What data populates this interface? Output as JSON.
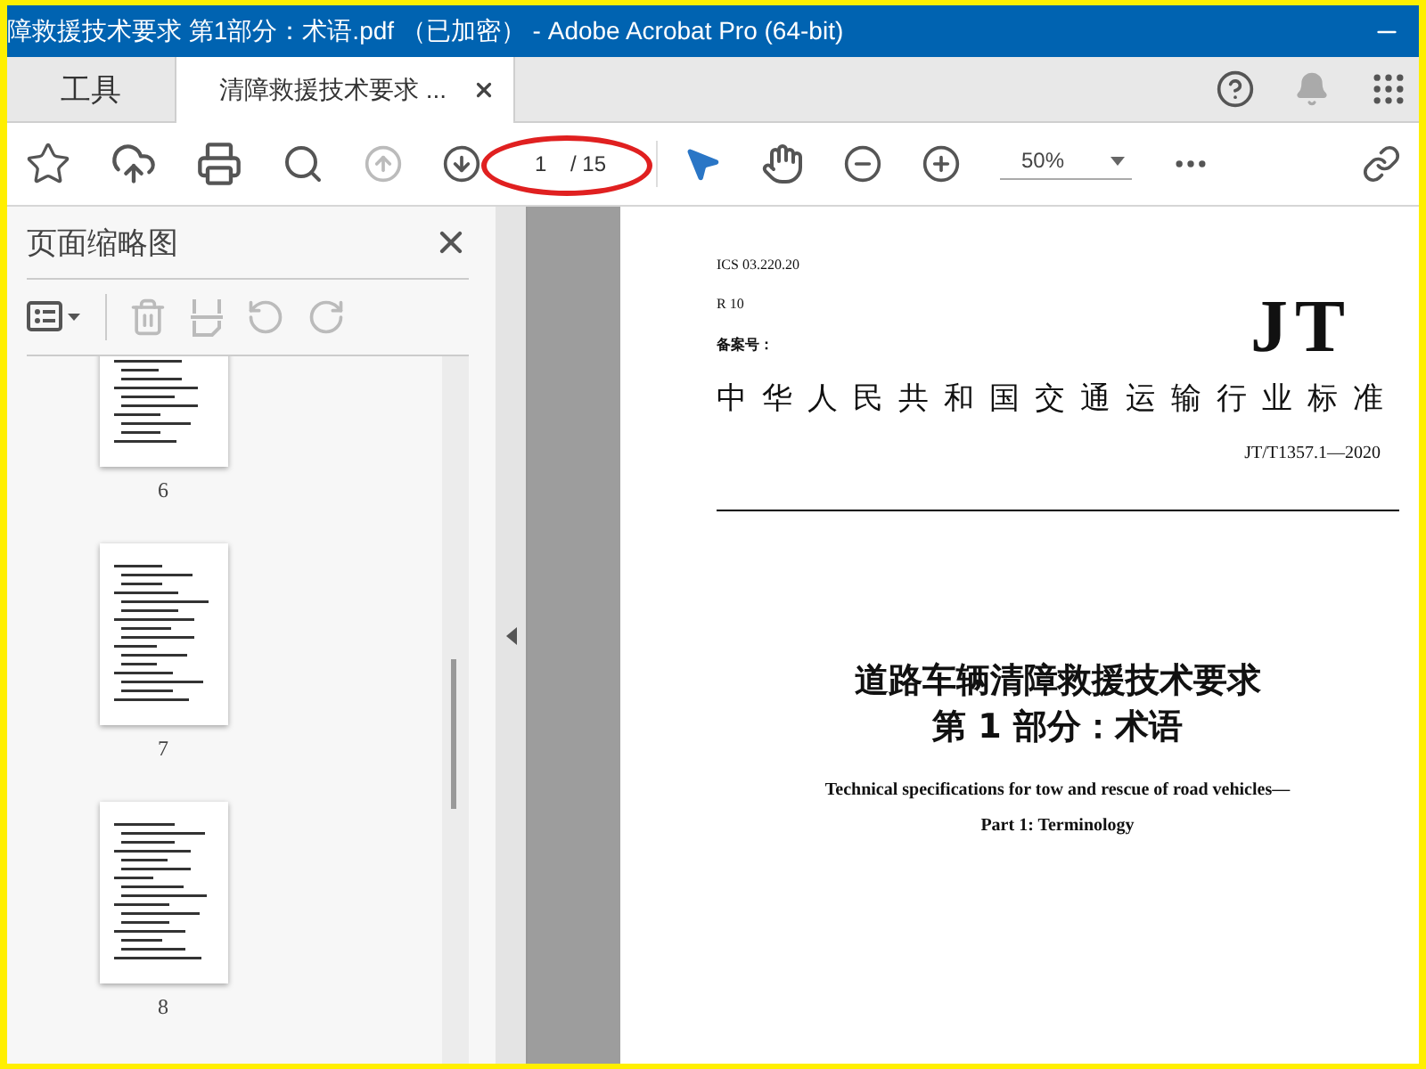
{
  "window": {
    "title": "障救援技术要求 第1部分：术语.pdf （已加密） - Adobe Acrobat Pro (64-bit)"
  },
  "tabs": [
    {
      "label": "工具",
      "selected": false
    },
    {
      "label": "清障救援技术要求 ...",
      "selected": true
    }
  ],
  "toolbar": {
    "page_value": "1",
    "page_total": "/ 15",
    "zoom": "50%"
  },
  "sidebar": {
    "title": "页面缩略图",
    "thumbnails": [
      {
        "label": "6"
      },
      {
        "label": "7"
      },
      {
        "label": "8"
      }
    ]
  },
  "document": {
    "ics": "ICS 03.220.20",
    "class_code": "R 10",
    "record_label": "备案号：",
    "logo": "JT",
    "standard_name": "中华人民共和国交通运输行业标准",
    "standard_code": "JT/T1357.1—2020",
    "title_lines": [
      "道路车辆清障救援技术要求",
      "第 1 部分：术语"
    ],
    "english_lines": [
      "Technical specifications for tow and rescue of road vehicles—",
      "Part 1: Terminology"
    ]
  }
}
